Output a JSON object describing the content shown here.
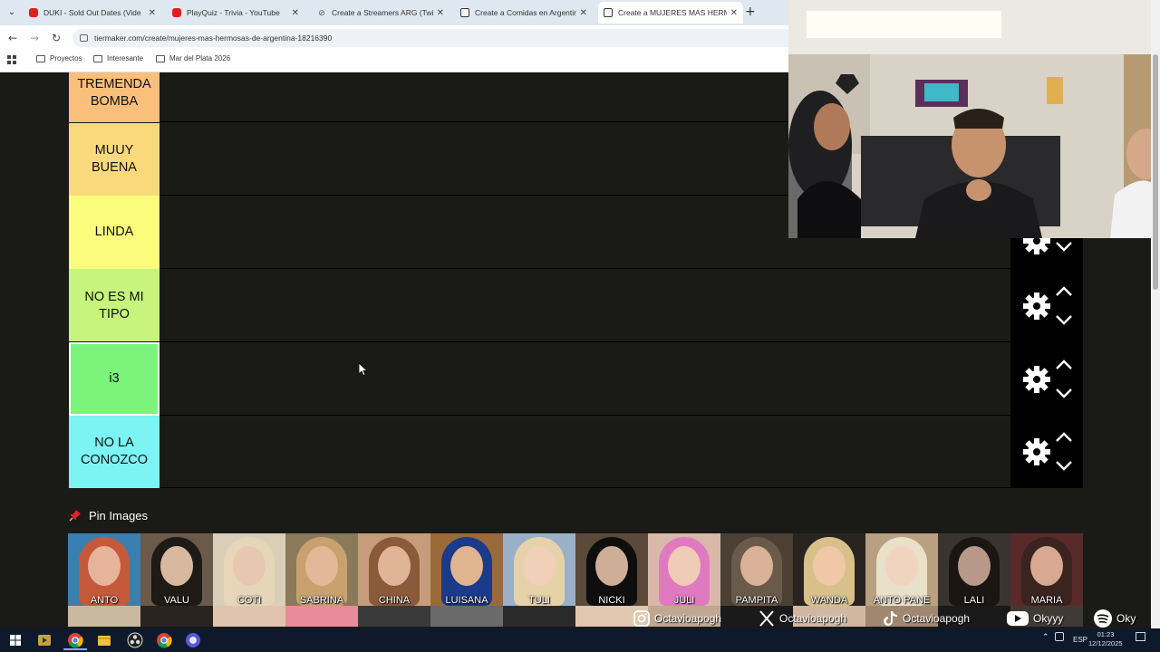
{
  "browser": {
    "tabs": [
      {
        "label": "DUKI - Sold Out Dates (Vide",
        "icon": "youtube-icon",
        "active": false
      },
      {
        "label": "PlayQuiz - Trivia - YouTube",
        "icon": "youtube-icon",
        "active": false
      },
      {
        "label": "Create a Streamers ARG (Twitch",
        "icon": "twitch-icon",
        "active": false
      },
      {
        "label": "Create a Comidas en Argentina",
        "icon": "tiermaker-icon",
        "active": false
      },
      {
        "label": "Create a MUJERES MAS HERMO",
        "icon": "tiermaker-icon",
        "active": true
      }
    ],
    "url": "tiermaker.com/create/mujeres-mas-hermosas-de-argentina-18216390",
    "bookmarks": [
      "Proyectos",
      "Interesante",
      "Mar del Plata 2026"
    ]
  },
  "tiers": [
    {
      "label": "TREMENDA\nBOMBA",
      "color": "#f9bf7b"
    },
    {
      "label": "MUUY\nBUENA",
      "color": "#fad97c"
    },
    {
      "label": "LINDA",
      "color": "#fbfb7c"
    },
    {
      "label": "NO ES MI\nTIPO",
      "color": "#c6f47c"
    },
    {
      "label": "i3",
      "color": "#7cf47c"
    },
    {
      "label": "NO LA\nCONOZCO",
      "color": "#7cf4f4"
    }
  ],
  "pin": {
    "title": "Pin Images",
    "images": [
      {
        "label": "ANTO",
        "palette": [
          "#c45a3a",
          "#e7b39a",
          "#3a7fb0"
        ]
      },
      {
        "label": "VALU",
        "palette": [
          "#1e1a16",
          "#d8b9a0",
          "#6b5a4a"
        ]
      },
      {
        "label": "COTI",
        "palette": [
          "#e6d6b8",
          "#e8c7b0",
          "#d9cfb8"
        ]
      },
      {
        "label": "SABRINA",
        "palette": [
          "#c9a16e",
          "#e2b898",
          "#8a7a5a"
        ]
      },
      {
        "label": "CHINA",
        "palette": [
          "#8a5a3a",
          "#e0b496",
          "#c69c7a"
        ]
      },
      {
        "label": "LUISANA",
        "palette": [
          "#1a3a8a",
          "#e0b48e",
          "#9a6a3a"
        ]
      },
      {
        "label": "TULI",
        "palette": [
          "#e6d2a8",
          "#f0d0b8",
          "#9ab0c8"
        ]
      },
      {
        "label": "NICKI",
        "palette": [
          "#0e0e0e",
          "#cfae98",
          "#5a4a3a"
        ]
      },
      {
        "label": "JULI",
        "palette": [
          "#e07ac0",
          "#f0cbb6",
          "#d8b8a8"
        ]
      },
      {
        "label": "PAMPITA",
        "palette": [
          "#6a5a4a",
          "#d9b196",
          "#4a4034"
        ]
      },
      {
        "label": "WANDA",
        "palette": [
          "#d8c08a",
          "#f0c8a8",
          "#2a2420"
        ]
      },
      {
        "label": "ANTO PANE",
        "palette": [
          "#e8e0c8",
          "#f0d4c0",
          "#b8a080"
        ]
      },
      {
        "label": "LALI",
        "palette": [
          "#1a1614",
          "#b89888",
          "#3a3430"
        ]
      },
      {
        "label": "MARIA",
        "palette": [
          "#3a2420",
          "#d8a890",
          "#5a2a2a"
        ]
      }
    ],
    "row2_palette": [
      "#c9b9a0",
      "#2a2420",
      "#e0c4b0",
      "#e88a9a",
      "#3a3a3a",
      "#6a6a6a",
      "#2a2a2a",
      "#e0c8b0",
      "#c0a890",
      "#1a1a1a",
      "#d0b8a0",
      "#a08870",
      "#1a1a1a",
      "#403a34"
    ]
  },
  "socials": [
    {
      "icon": "instagram-icon",
      "handle": "Octavioapogh"
    },
    {
      "icon": "x-icon",
      "handle": "Octavioapogh"
    },
    {
      "icon": "tiktok-icon",
      "handle": "Octavioapogh"
    },
    {
      "icon": "youtube-icon",
      "handle": "Okyyy"
    },
    {
      "icon": "spotify-icon",
      "handle": "Oky"
    }
  ],
  "taskbar": {
    "lang": "ESP",
    "time": "01:23",
    "date": "12/12/2025"
  },
  "colors": {
    "page_bg": "#1a1a17",
    "control_bg": "#000000",
    "taskbar": "#0e1a2b"
  }
}
